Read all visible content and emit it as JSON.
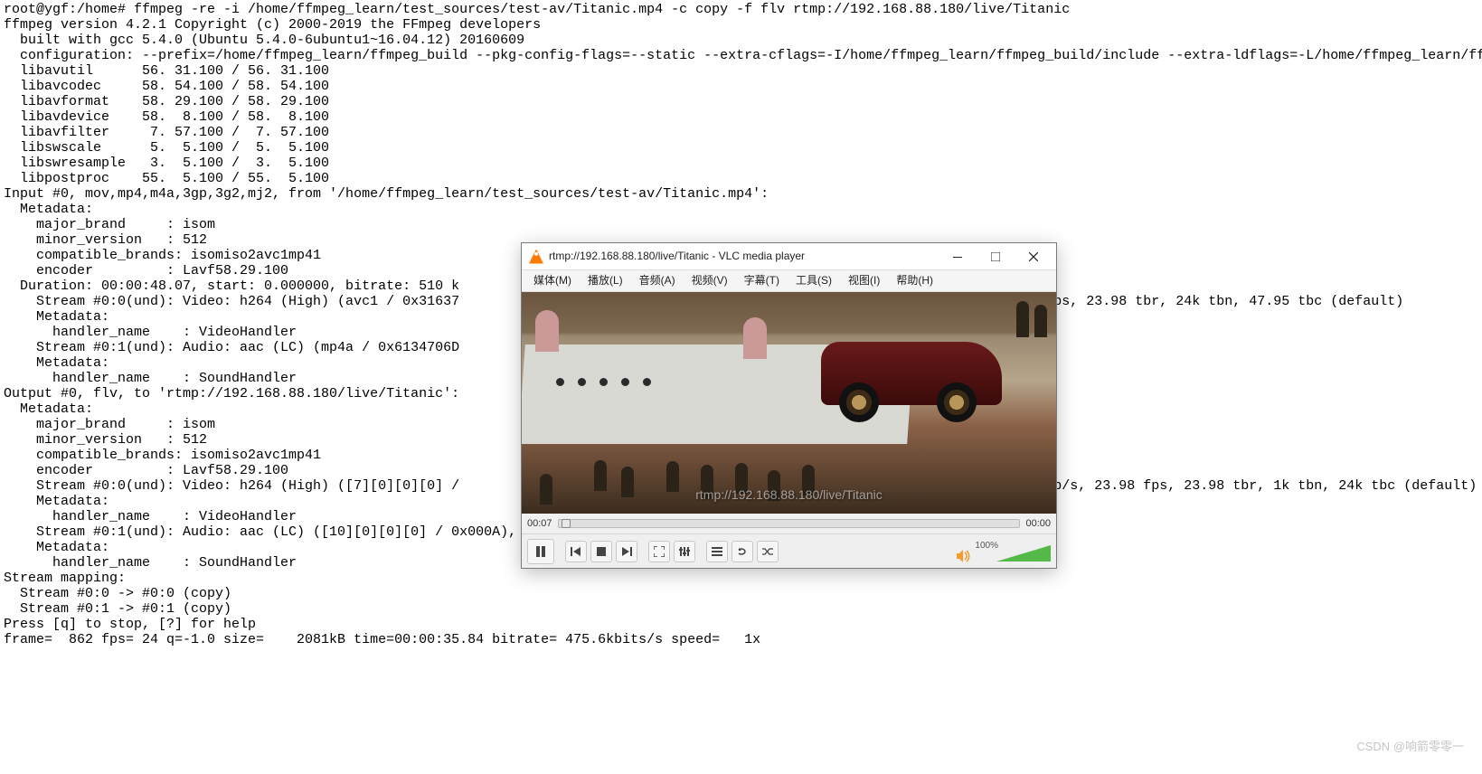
{
  "terminal": {
    "lines": [
      "root@ygf:/home# ffmpeg -re -i /home/ffmpeg_learn/test_sources/test-av/Titanic.mp4 -c copy -f flv rtmp://192.168.88.180/live/Titanic",
      "ffmpeg version 4.2.1 Copyright (c) 2000-2019 the FFmpeg developers",
      "  built with gcc 5.4.0 (Ubuntu 5.4.0-6ubuntu1~16.04.12) 20160609",
      "  configuration: --prefix=/home/ffmpeg_learn/ffmpeg_build --pkg-config-flags=--static --extra-cflags=-I/home/ffmpeg_learn/ffmpeg_build/include --extra-ldflags=-L/home/ffmpeg_learn/ffmpeg_build/lib --extra-libs='-lpthread -lm' --bindir=/home/ffmpeg_learn/bin --enable-gpl --enable-libass --enable-libfdk-aac --enable-libfreetype --enable-libmp3lame --enable-libopus --enable-libvorbis --enable-libvpx --enable-libx264 --enable-libx265 --enable-pic --enable-shared --enable-nonfree",
      "  libavutil      56. 31.100 / 56. 31.100",
      "  libavcodec     58. 54.100 / 58. 54.100",
      "  libavformat    58. 29.100 / 58. 29.100",
      "  libavdevice    58.  8.100 / 58.  8.100",
      "  libavfilter     7. 57.100 /  7. 57.100",
      "  libswscale      5.  5.100 /  5.  5.100",
      "  libswresample   3.  5.100 /  3.  5.100",
      "  libpostproc    55.  5.100 / 55.  5.100",
      "Input #0, mov,mp4,m4a,3gp,3g2,mj2, from '/home/ffmpeg_learn/test_sources/test-av/Titanic.mp4':",
      "  Metadata:",
      "    major_brand     : isom",
      "    minor_version   : 512",
      "    compatible_brands: isomiso2avc1mp41",
      "    encoder         : Lavf58.29.100",
      "  Duration: 00:00:48.07, start: 0.000000, bitrate: 510 k",
      "    Stream #0:0(und): Video: h264 (High) (avc1 / 0x31637                                                                      8 fps, 23.98 tbr, 24k tbn, 47.95 tbc (default)",
      "    Metadata:",
      "      handler_name    : VideoHandler",
      "    Stream #0:1(und): Audio: aac (LC) (mp4a / 0x6134706D",
      "    Metadata:",
      "      handler_name    : SoundHandler",
      "Output #0, flv, to 'rtmp://192.168.88.180/live/Titanic':",
      "  Metadata:",
      "    major_brand     : isom",
      "    minor_version   : 512",
      "    compatible_brands: isomiso2avc1mp41",
      "    encoder         : Lavf58.29.100",
      "    Stream #0:0(und): Video: h264 (High) ([7][0][0][0] /                                                                      5 kb/s, 23.98 fps, 23.98 tbr, 1k tbn, 24k tbc (default)",
      "    Metadata:",
      "      handler_name    : VideoHandler",
      "    Stream #0:1(und): Audio: aac (LC) ([10][0][0][0] / 0x000A), 48000 Hz, stereo, fltp, 128 kb/s (default)",
      "    Metadata:",
      "      handler_name    : SoundHandler",
      "Stream mapping:",
      "  Stream #0:0 -> #0:0 (copy)",
      "  Stream #0:1 -> #0:1 (copy)",
      "Press [q] to stop, [?] for help",
      "frame=  862 fps= 24 q=-1.0 size=    2081kB time=00:00:35.84 bitrate= 475.6kbits/s speed=   1x"
    ]
  },
  "vlc": {
    "title": "rtmp://192.168.88.180/live/Titanic - VLC media player",
    "menus": {
      "media": "媒体(M)",
      "playback": "播放(L)",
      "audio": "音频(A)",
      "video": "视频(V)",
      "subtitle": "字幕(T)",
      "tools": "工具(S)",
      "view": "视图(I)",
      "help": "帮助(H)"
    },
    "overlay_url": "rtmp://192.168.88.180/live/Titanic",
    "time_elapsed": "00:07",
    "time_remaining": "00:00",
    "volume_pct": "100%"
  },
  "watermark": "CSDN @响箭零零一",
  "colors": {
    "text": "#000000",
    "vlc_bg": "#f0f0f0",
    "vol_fill": "#54b948"
  }
}
